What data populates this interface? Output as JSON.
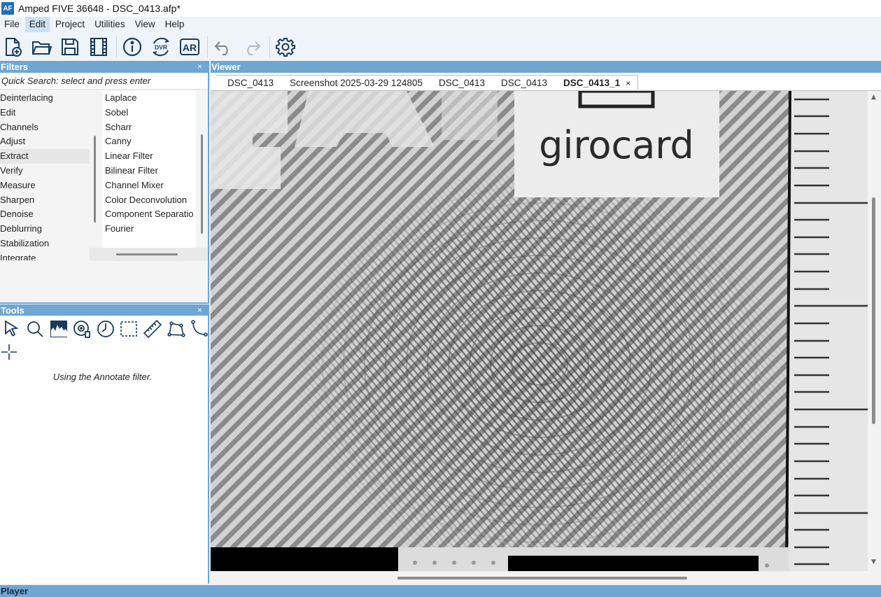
{
  "window": {
    "logo_text": "AF",
    "title": "Amped FIVE 36648 - DSC_0413.afp*"
  },
  "menu": [
    {
      "label": "File",
      "active": false
    },
    {
      "label": "Edit",
      "active": true
    },
    {
      "label": "Project",
      "active": false
    },
    {
      "label": "Utilities",
      "active": false
    },
    {
      "label": "View",
      "active": false
    },
    {
      "label": "Help",
      "active": false
    }
  ],
  "toolbar": {
    "icons": [
      "new-project-icon",
      "open-folder-icon",
      "save-icon",
      "video-film-icon",
      "info-icon",
      "dvr-icon",
      "ar-icon",
      "undo-icon",
      "redo-icon",
      "settings-gear-icon"
    ],
    "dvr_label": "DVR",
    "ar_label": "AR",
    "accent": "#1a3a5c"
  },
  "filters": {
    "header": "Filters",
    "close": "×",
    "quick_search": "Quick Search: select and press enter",
    "categories": [
      "Deinterlacing",
      "Edit",
      "Channels",
      "Adjust",
      "Extract",
      "Verify",
      "Measure",
      "Sharpen",
      "Denoise",
      "Deblurring",
      "Stabilization",
      "Integrate"
    ],
    "selected_category": "Extract",
    "items": [
      "Laplace",
      "Sobel",
      "Scharr",
      "Canny",
      "Linear Filter",
      "Bilinear Filter",
      "Channel Mixer",
      "Color Deconvolution",
      "Component Separatio",
      "Fourier"
    ]
  },
  "tools": {
    "header": "Tools",
    "close": "×",
    "icons": [
      "pointer-icon",
      "zoom-icon",
      "histogram-icon",
      "disc-icon",
      "clock-icon",
      "selection-rect-icon",
      "ruler-icon",
      "polygon-icon",
      "curve-icon",
      "crosshair-icon"
    ],
    "status": "Using the Annotate filter."
  },
  "viewer": {
    "header": "Viewer",
    "tabs": [
      {
        "label": "DSC_0413",
        "active": false
      },
      {
        "label": "Screenshot 2025-03-29 124805",
        "active": false
      },
      {
        "label": "DSC_0413",
        "active": false
      },
      {
        "label": "DSC_0413",
        "active": false
      },
      {
        "label": "DSC_0413_1",
        "active": true
      }
    ],
    "tab_close": "×",
    "image_text": "girocard"
  },
  "player": {
    "header": "Player"
  },
  "colors": {
    "panel_header": "#6fa6d2",
    "menu_bg": "#eef4fa",
    "menu_active": "#cde0f2"
  }
}
